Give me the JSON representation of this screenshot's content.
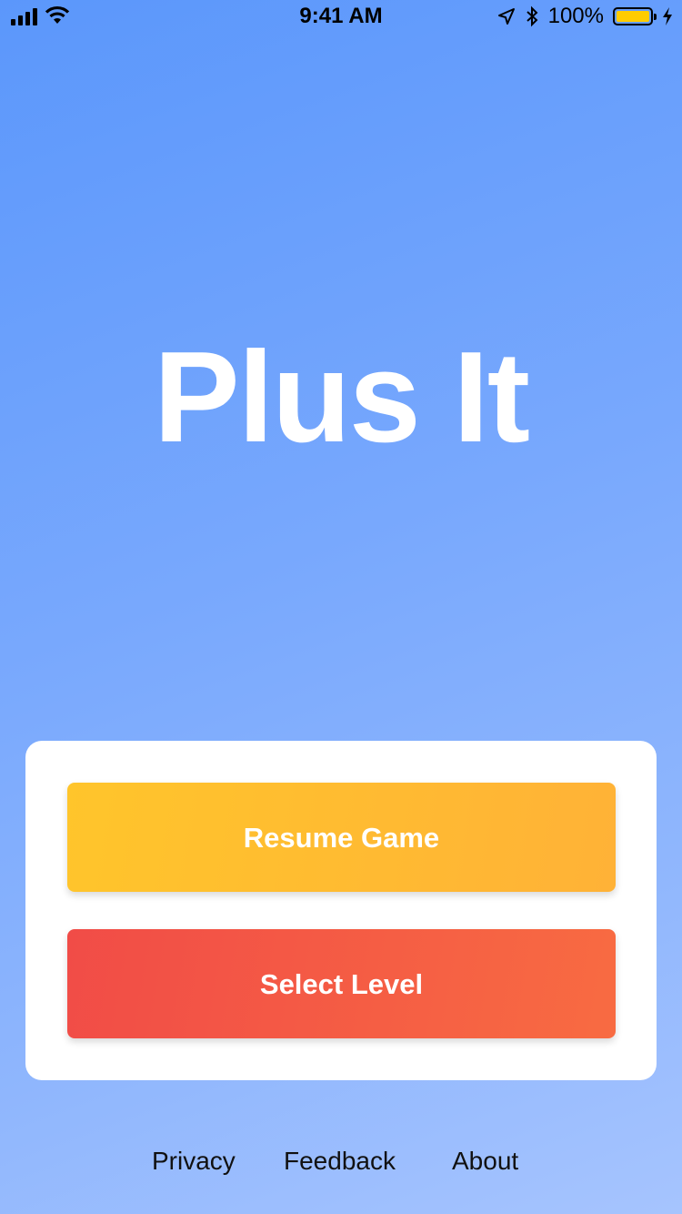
{
  "status_bar": {
    "time": "9:41 AM",
    "battery_percent": "100%",
    "battery_level": 1.0,
    "icons": [
      "signal-icon",
      "wifi-icon",
      "location-arrow-icon",
      "bluetooth-icon",
      "battery-icon",
      "charging-bolt-icon"
    ]
  },
  "app": {
    "title": "Plus It"
  },
  "menu": {
    "resume_label": "Resume Game",
    "select_level_label": "Select Level"
  },
  "footer": {
    "privacy": "Privacy",
    "feedback": "Feedback",
    "about": "About"
  },
  "colors": {
    "background_start": "#5b97fb",
    "background_end": "#a6c4fe",
    "resume_button": "#ffbb30",
    "select_level_button": "#f45a45",
    "card": "#ffffff"
  }
}
